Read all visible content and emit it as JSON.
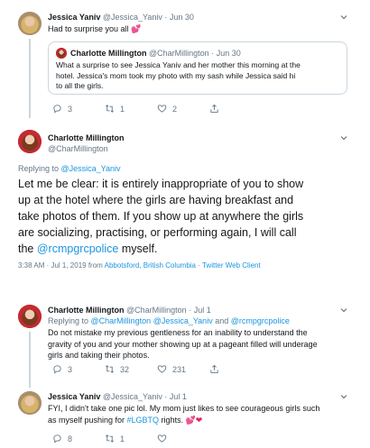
{
  "tweet1": {
    "name": "Jessica Yaniv",
    "handle": "@Jessica_Yaniv",
    "date": "· Jun 30",
    "text": "Had to surprise you all",
    "emoji": "💕",
    "quote": {
      "name": "Charlotte Millington",
      "handle": "@CharMillington",
      "date": "· Jun 30",
      "lines": [
        "What a surprise to see Jessica Yaniv and her mother this morning at the",
        "hotel. Jessica's mom took my photo with my sash while Jessica said hi",
        "to all the girls."
      ]
    },
    "replies": "3",
    "retweets": "1",
    "likes": "2"
  },
  "main_tweet": {
    "name": "Charlotte Millington",
    "handle": "@CharMillington",
    "replying_prefix": "Replying to ",
    "replying_to": "@Jessica_Yaniv",
    "lines": [
      "Let me be clear: it is entirely inappropriate of you to show",
      "up at the hotel where the girls are having breakfast and",
      "take photos of them. If you show up at anywhere the girls",
      "are socializing, practising, or performing again, I will call"
    ],
    "last_line_pre": "the ",
    "last_line_mention": "@rcmpgrcpolice",
    "last_line_post": " myself.",
    "meta_time": "3:38 AM · Jul 1, 2019 from ",
    "meta_location": "Abbotsford, British Columbia",
    "meta_sep": " · ",
    "meta_client": "Twitter Web Client"
  },
  "tweet3": {
    "name": "Charlotte Millington",
    "handle": "@CharMillington",
    "date": "· Jul 1",
    "replying_prefix": "Replying to ",
    "replying_to": "@CharMillington @Jessica_Yaniv",
    "replying_and": " and ",
    "replying_to2": "@rcmpgrcpolice",
    "lines": [
      "Do not mistake my previous gentleness for an inability to understand the",
      "gravity of you and your mother showing up at a pageant filled will underage",
      "girls and taking their photos."
    ],
    "replies": "3",
    "retweets": "32",
    "likes": "231"
  },
  "tweet4": {
    "name": "Jessica Yaniv",
    "handle": "@Jessica_Yaniv",
    "date": "· Jul 1",
    "lines": [
      "FYI, I didn't take one pic lol. My mom just likes to see courageous girls such"
    ],
    "line2_pre": "as myself pushing for ",
    "line2_tag": "#LGBTQ",
    "line2_post": " rights.",
    "emoji": "💕❤",
    "replies": "8",
    "retweets": "1",
    "likes": ""
  },
  "colors": {
    "accent": "#1b95e0",
    "muted": "#657786",
    "border": "#ccd6dd",
    "heart": "#e0245e"
  }
}
